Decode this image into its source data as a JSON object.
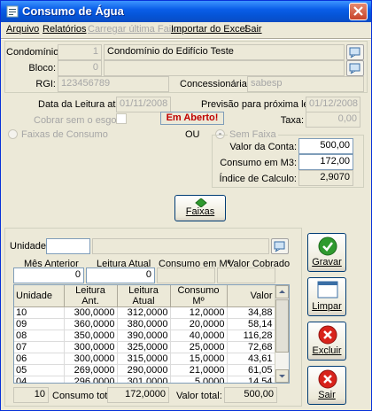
{
  "window": {
    "title": "Consumo de Água"
  },
  "menu": [
    {
      "label": "Arquivo",
      "disabled": false
    },
    {
      "label": "Relatórios",
      "disabled": false
    },
    {
      "label": "Carregar última Faixa",
      "disabled": true
    },
    {
      "label": "Importar do Excel",
      "disabled": false
    },
    {
      "label": "Sair",
      "disabled": false
    }
  ],
  "condominio": {
    "label": "Condomínio:",
    "code": "1",
    "name": "Condomínio do Edifício Teste",
    "bloco_label": "Bloco:",
    "bloco_code": "0",
    "rgi_label": "RGI:",
    "rgi_value": "123456789",
    "concessionaria_label": "Concessionária:",
    "concessionaria_value": "sabesp"
  },
  "leitura": {
    "data_label": "Data da Leitura atual:",
    "data_value": "01/11/2008",
    "previsao_label": "Previsão para próxima leitura:",
    "previsao_value": "01/12/2008",
    "cobrar_label": "Cobrar sem o esgoto",
    "status": "Em Aberto!",
    "taxa_label": "Taxa:",
    "taxa_value": "0,00"
  },
  "modo": {
    "faixas_label": "Faixas de Consumo",
    "ou_label": "OU",
    "sem_faixa_label": "Sem Faixa"
  },
  "conta": {
    "valor_label": "Valor da Conta:",
    "valor_value": "500,00",
    "consumo_label": "Consumo em M3:",
    "consumo_value": "172,00",
    "indice_label": "Índice de Calculo:",
    "indice_value": "2,9070"
  },
  "faixas_button": {
    "label": "Faixas"
  },
  "unidade": {
    "label": "Unidade:",
    "value": "",
    "mes_anterior_label": "Mês Anterior",
    "mes_anterior_value": "0",
    "leitura_atual_label": "Leitura Atual",
    "leitura_atual_value": "0",
    "consumo_label": "Consumo em Mº",
    "consumo_value": "",
    "valor_label": "Valor Cobrado",
    "valor_value": ""
  },
  "grid": {
    "columns": [
      "Unidade",
      "Leitura Ant.",
      "Leitura Atual",
      "Consumo Mº",
      "Valor"
    ],
    "rows": [
      [
        "10",
        "300,0000",
        "312,0000",
        "12,0000",
        "34,88"
      ],
      [
        "09",
        "360,0000",
        "380,0000",
        "20,0000",
        "58,14"
      ],
      [
        "08",
        "350,0000",
        "390,0000",
        "40,0000",
        "116,28"
      ],
      [
        "07",
        "300,0000",
        "325,0000",
        "25,0000",
        "72,68"
      ],
      [
        "06",
        "300,0000",
        "315,0000",
        "15,0000",
        "43,61"
      ],
      [
        "05",
        "269,0000",
        "290,0000",
        "21,0000",
        "61,05"
      ],
      [
        "04",
        "296,0000",
        "301,0000",
        "5,0000",
        "14,54"
      ]
    ]
  },
  "footer": {
    "count": "10",
    "consumo_total_label": "Consumo total:",
    "consumo_total_value": "172,0000",
    "valor_total_label": "Valor total:",
    "valor_total_value": "500,00"
  },
  "actions": {
    "gravar": "Gravar",
    "limpar": "Limpar",
    "excluir": "Excluir",
    "sair": "Sair"
  },
  "colors": {
    "titlebar": "#0554d6",
    "status_text": "#c00000",
    "ok_green": "#2f9a2f",
    "danger_red": "#d8231b"
  }
}
